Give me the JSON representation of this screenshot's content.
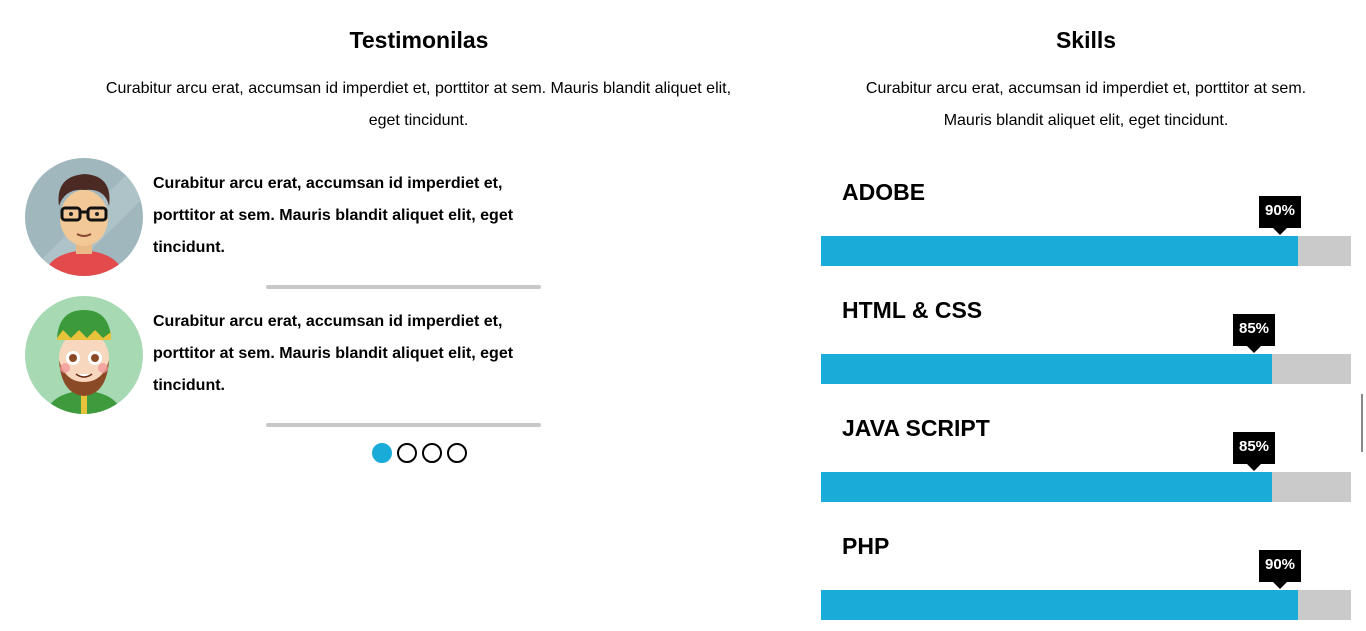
{
  "testimonials": {
    "title": "Testimonilas",
    "description": "Curabitur arcu erat, accumsan id imperdiet et, porttitor at sem. Mauris blandit aliquet elit, eget tincidunt.",
    "items": [
      {
        "quote": "Curabitur arcu erat, accumsan id imperdiet et, porttitor at sem. Mauris blandit aliquet elit, eget tincidunt.",
        "avatar_icon": "man-with-glasses-avatar-icon"
      },
      {
        "quote": "Curabitur arcu erat, accumsan id imperdiet et, porttitor at sem. Mauris blandit aliquet elit, eget tincidunt.",
        "avatar_icon": "bearded-man-green-hat-avatar-icon"
      }
    ],
    "pagination": {
      "count": 4,
      "active_index": 0
    }
  },
  "skills": {
    "title": "Skills",
    "description": "Curabitur arcu erat, accumsan id imperdiet et, porttitor at sem. Mauris blandit aliquet elit, eget tincidunt.",
    "items": [
      {
        "name": "ADOBE",
        "percent_label": "90%",
        "level": 0.9
      },
      {
        "name": "HTML & CSS",
        "percent_label": "85%",
        "level": 0.85
      },
      {
        "name": "JAVA SCRIPT",
        "percent_label": "85%",
        "level": 0.85
      },
      {
        "name": "PHP",
        "percent_label": "90%",
        "level": 0.9
      }
    ]
  },
  "colors": {
    "accent": "#1aacd9",
    "track": "#cacaca",
    "divider": "#c8c8c8",
    "badge": "#000000"
  }
}
